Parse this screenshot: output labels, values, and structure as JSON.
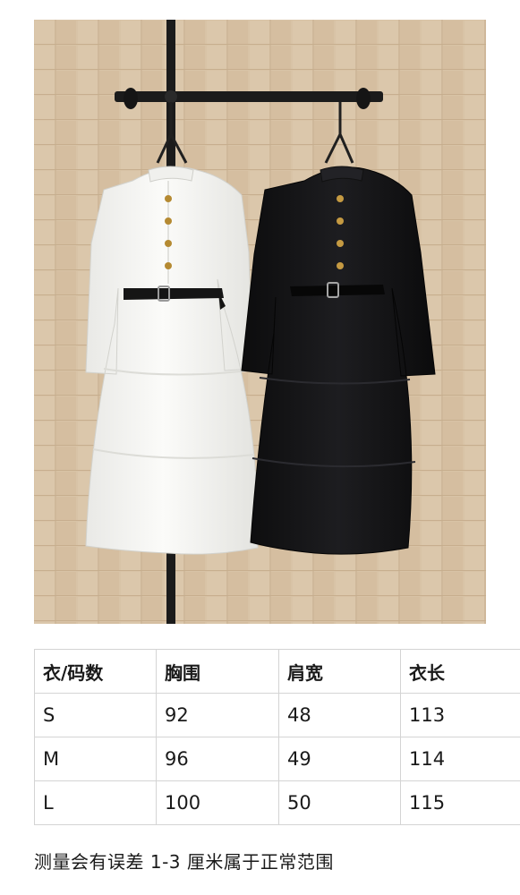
{
  "photo": {
    "subject": "white dress and black dress on hangers",
    "wall_color": "#d6c0a3",
    "rack_color": "#1b1b1b"
  },
  "size_table": {
    "headers": [
      "衣/码数",
      "胸围",
      "肩宽",
      "衣长"
    ],
    "rows": [
      [
        "S",
        "92",
        "48",
        "113"
      ],
      [
        "M",
        "96",
        "49",
        "114"
      ],
      [
        "L",
        "100",
        "50",
        "115"
      ]
    ]
  },
  "note": "测量会有误差 1-3 厘米属于正常范围"
}
